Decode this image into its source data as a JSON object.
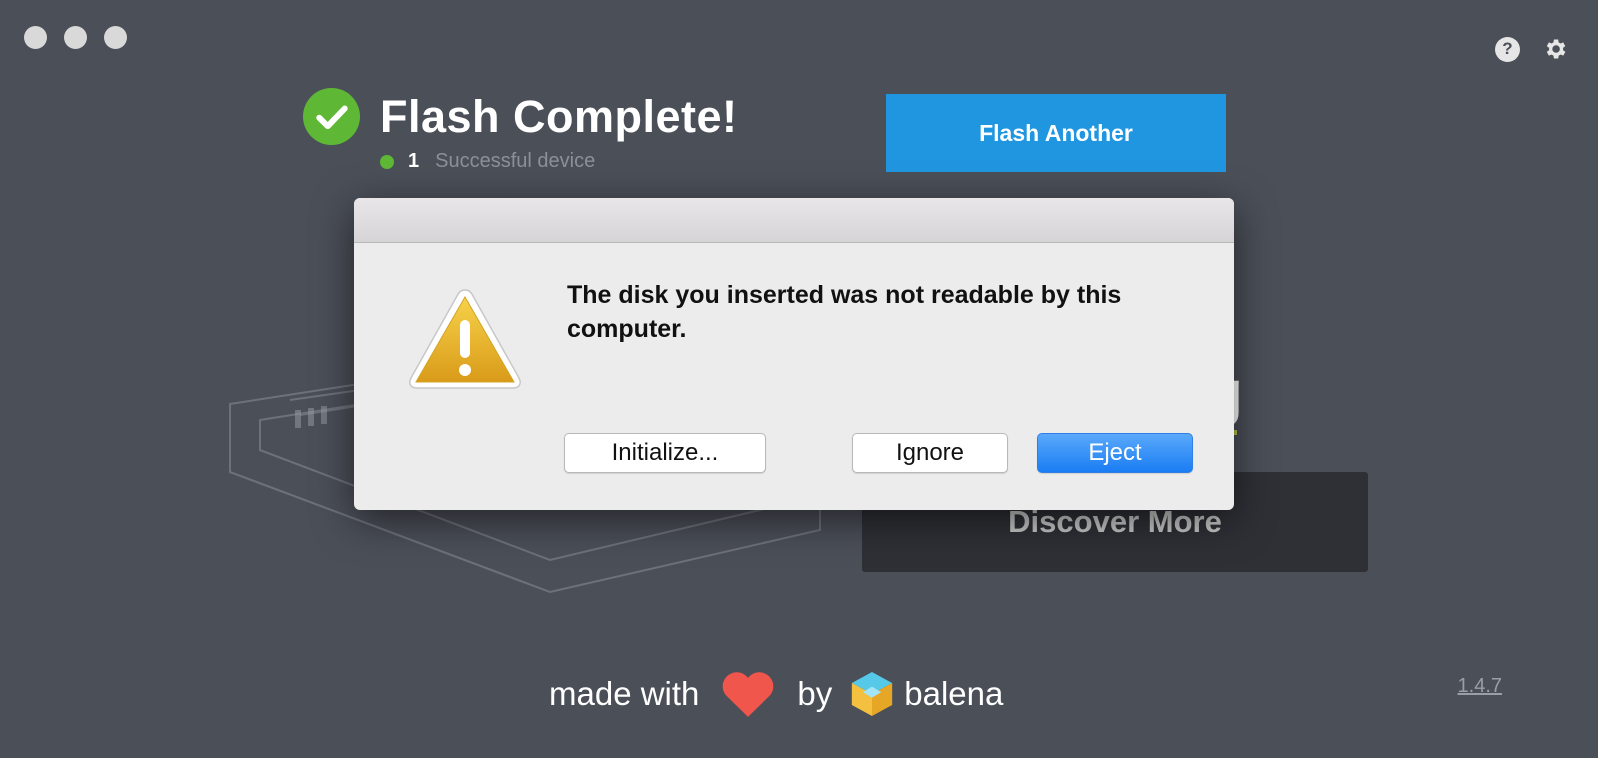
{
  "status": {
    "title": "Flash Complete!",
    "device_count": "1",
    "device_label": "Successful device"
  },
  "actions": {
    "flash_another": "Flash Another"
  },
  "promo": {
    "heading_fragment": "g",
    "discover_label": "Discover More"
  },
  "footer": {
    "made_with": "made with",
    "by": "by",
    "brand": "balena",
    "version": "1.4.7"
  },
  "dialog": {
    "message": "The disk you inserted was not readable by this computer.",
    "buttons": {
      "initialize": "Initialize...",
      "ignore": "Ignore",
      "eject": "Eject"
    }
  },
  "colors": {
    "accent": "#2196e0",
    "success": "#5fb835",
    "background": "#4b4f58",
    "heart": "#f0564c"
  }
}
